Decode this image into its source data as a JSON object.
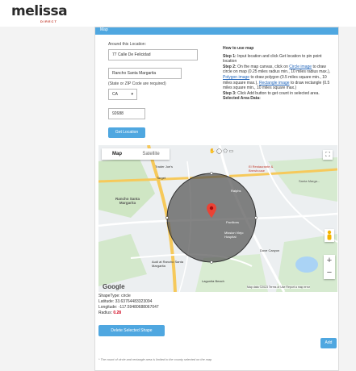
{
  "brand": {
    "name": "melissa",
    "sub": "DIRECT"
  },
  "panel": {
    "header": "Map"
  },
  "form": {
    "around_label": "Around this Location:",
    "address_value": "77 Calle De Felicidad",
    "city_value": "Rancho Santa Margarita",
    "state_zip_label": "(State or ZIP Code are required)",
    "state_value": "CA",
    "zip_value": "92688",
    "get_location_button": "Get Location"
  },
  "howto": {
    "title": "How to use map",
    "step1_label": "Step 1:",
    "step1_text": "Input location and click Get location to pin point location",
    "step2_label": "Step 2:",
    "step2_text": "On the map canvas, click on",
    "circle_link": "Circle image",
    "circle_text": "to draw circle on map (0.25 miles radius min., 10 miles radius max.),",
    "polygon_link": "Polygon image",
    "polygon_text": "to draw polygon (0.5 miles square min., 10 miles square max.),",
    "rectangle_link": "Rectangle image",
    "rectangle_text": "to draw rectangle (0.5 miles square min., 10 miles square max.)",
    "step3_label": "Step 3:",
    "step3_text": "Click Add button to get count in selected area.",
    "selected_area": "Selected Area Data:"
  },
  "map": {
    "tab_map": "Map",
    "tab_satellite": "Satellite",
    "labels": {
      "trader_joes": "Trader Joe's",
      "target": "Target",
      "el_restaurant": "El Restaurante & Brewhouse",
      "rancho_santa_margarita": "Rancho Santa Margarita",
      "ralphs": "Ralphs",
      "santa_margarita": "Santa Marga...",
      "pavilions": "Pavilions",
      "mission_viejo": "Mission Viejo Hospital",
      "audi": "Audi at Rancho Santa Margarita",
      "lagunita": "Lagunita Beach",
      "dove_canyon": "Dove Canyon"
    },
    "google": "Google",
    "attribution": "Map data ©2023   Terms of Use   Report a map error"
  },
  "result": {
    "shape_type": "ShapeType: circle",
    "latitude": "Latitude: 33.63764483323094",
    "longitude": "Longitude: -117.59480688067047",
    "radius_label": "Radius:",
    "radius_value": "0.28"
  },
  "buttons": {
    "delete_selected": "Delete Selected Shape",
    "add": "Add"
  },
  "footnote": "* The count of circle and rectangle area is limited to the county selected on the map",
  "colors": {
    "accent": "#4fa7e0",
    "radius": "#d0021b",
    "pin": "#ea4335"
  }
}
